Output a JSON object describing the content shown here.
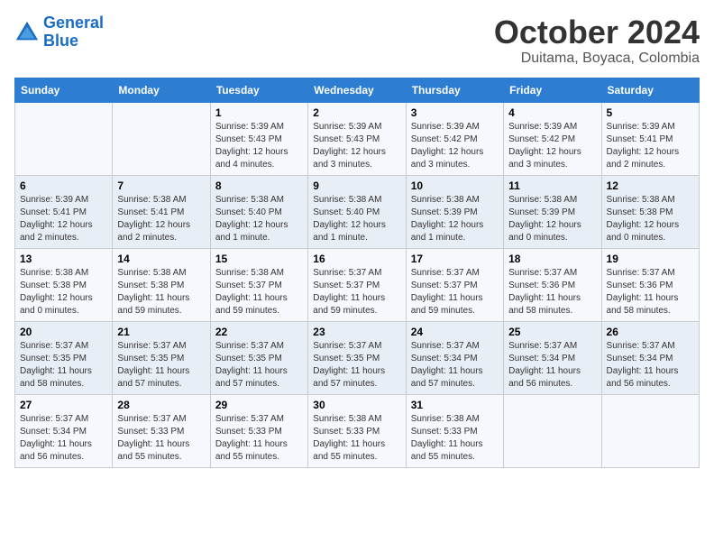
{
  "header": {
    "logo_line1": "General",
    "logo_line2": "Blue",
    "main_title": "October 2024",
    "subtitle": "Duitama, Boyaca, Colombia"
  },
  "calendar": {
    "weekdays": [
      "Sunday",
      "Monday",
      "Tuesday",
      "Wednesday",
      "Thursday",
      "Friday",
      "Saturday"
    ],
    "weeks": [
      [
        {
          "day": "",
          "info": ""
        },
        {
          "day": "",
          "info": ""
        },
        {
          "day": "1",
          "info": "Sunrise: 5:39 AM\nSunset: 5:43 PM\nDaylight: 12 hours and 4 minutes."
        },
        {
          "day": "2",
          "info": "Sunrise: 5:39 AM\nSunset: 5:43 PM\nDaylight: 12 hours and 3 minutes."
        },
        {
          "day": "3",
          "info": "Sunrise: 5:39 AM\nSunset: 5:42 PM\nDaylight: 12 hours and 3 minutes."
        },
        {
          "day": "4",
          "info": "Sunrise: 5:39 AM\nSunset: 5:42 PM\nDaylight: 12 hours and 3 minutes."
        },
        {
          "day": "5",
          "info": "Sunrise: 5:39 AM\nSunset: 5:41 PM\nDaylight: 12 hours and 2 minutes."
        }
      ],
      [
        {
          "day": "6",
          "info": "Sunrise: 5:39 AM\nSunset: 5:41 PM\nDaylight: 12 hours and 2 minutes."
        },
        {
          "day": "7",
          "info": "Sunrise: 5:38 AM\nSunset: 5:41 PM\nDaylight: 12 hours and 2 minutes."
        },
        {
          "day": "8",
          "info": "Sunrise: 5:38 AM\nSunset: 5:40 PM\nDaylight: 12 hours and 1 minute."
        },
        {
          "day": "9",
          "info": "Sunrise: 5:38 AM\nSunset: 5:40 PM\nDaylight: 12 hours and 1 minute."
        },
        {
          "day": "10",
          "info": "Sunrise: 5:38 AM\nSunset: 5:39 PM\nDaylight: 12 hours and 1 minute."
        },
        {
          "day": "11",
          "info": "Sunrise: 5:38 AM\nSunset: 5:39 PM\nDaylight: 12 hours and 0 minutes."
        },
        {
          "day": "12",
          "info": "Sunrise: 5:38 AM\nSunset: 5:38 PM\nDaylight: 12 hours and 0 minutes."
        }
      ],
      [
        {
          "day": "13",
          "info": "Sunrise: 5:38 AM\nSunset: 5:38 PM\nDaylight: 12 hours and 0 minutes."
        },
        {
          "day": "14",
          "info": "Sunrise: 5:38 AM\nSunset: 5:38 PM\nDaylight: 11 hours and 59 minutes."
        },
        {
          "day": "15",
          "info": "Sunrise: 5:38 AM\nSunset: 5:37 PM\nDaylight: 11 hours and 59 minutes."
        },
        {
          "day": "16",
          "info": "Sunrise: 5:37 AM\nSunset: 5:37 PM\nDaylight: 11 hours and 59 minutes."
        },
        {
          "day": "17",
          "info": "Sunrise: 5:37 AM\nSunset: 5:37 PM\nDaylight: 11 hours and 59 minutes."
        },
        {
          "day": "18",
          "info": "Sunrise: 5:37 AM\nSunset: 5:36 PM\nDaylight: 11 hours and 58 minutes."
        },
        {
          "day": "19",
          "info": "Sunrise: 5:37 AM\nSunset: 5:36 PM\nDaylight: 11 hours and 58 minutes."
        }
      ],
      [
        {
          "day": "20",
          "info": "Sunrise: 5:37 AM\nSunset: 5:35 PM\nDaylight: 11 hours and 58 minutes."
        },
        {
          "day": "21",
          "info": "Sunrise: 5:37 AM\nSunset: 5:35 PM\nDaylight: 11 hours and 57 minutes."
        },
        {
          "day": "22",
          "info": "Sunrise: 5:37 AM\nSunset: 5:35 PM\nDaylight: 11 hours and 57 minutes."
        },
        {
          "day": "23",
          "info": "Sunrise: 5:37 AM\nSunset: 5:35 PM\nDaylight: 11 hours and 57 minutes."
        },
        {
          "day": "24",
          "info": "Sunrise: 5:37 AM\nSunset: 5:34 PM\nDaylight: 11 hours and 57 minutes."
        },
        {
          "day": "25",
          "info": "Sunrise: 5:37 AM\nSunset: 5:34 PM\nDaylight: 11 hours and 56 minutes."
        },
        {
          "day": "26",
          "info": "Sunrise: 5:37 AM\nSunset: 5:34 PM\nDaylight: 11 hours and 56 minutes."
        }
      ],
      [
        {
          "day": "27",
          "info": "Sunrise: 5:37 AM\nSunset: 5:34 PM\nDaylight: 11 hours and 56 minutes."
        },
        {
          "day": "28",
          "info": "Sunrise: 5:37 AM\nSunset: 5:33 PM\nDaylight: 11 hours and 55 minutes."
        },
        {
          "day": "29",
          "info": "Sunrise: 5:37 AM\nSunset: 5:33 PM\nDaylight: 11 hours and 55 minutes."
        },
        {
          "day": "30",
          "info": "Sunrise: 5:38 AM\nSunset: 5:33 PM\nDaylight: 11 hours and 55 minutes."
        },
        {
          "day": "31",
          "info": "Sunrise: 5:38 AM\nSunset: 5:33 PM\nDaylight: 11 hours and 55 minutes."
        },
        {
          "day": "",
          "info": ""
        },
        {
          "day": "",
          "info": ""
        }
      ]
    ]
  }
}
